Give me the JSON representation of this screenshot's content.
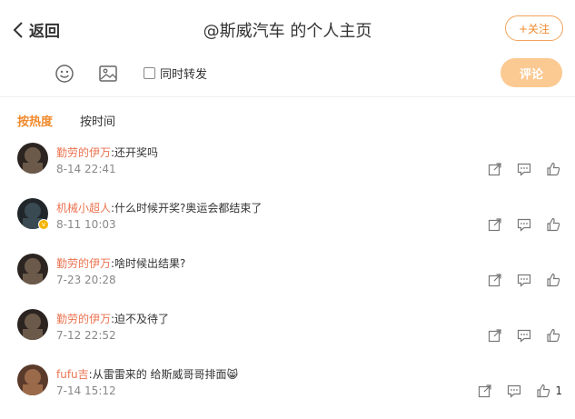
{
  "header": {
    "back_label": "返回",
    "title": "@斯威汽车 的个人主页",
    "follow_label": "+关注"
  },
  "toolbar": {
    "icons": [
      "emoji-icon",
      "image-icon"
    ],
    "repost_label": "同时转发",
    "comment_button": "评论"
  },
  "tabs": {
    "hot": "按热度",
    "time": "按时间"
  },
  "colors": {
    "accent": "#f08a2c",
    "username": "#eb7350",
    "comment_button_bg": "#fbc992",
    "meta": "#888888"
  },
  "comments": [
    {
      "user": "勤劳的伊万",
      "text": ":还开奖吗",
      "time": "8-14 22:41",
      "verified": false,
      "likes": ""
    },
    {
      "user": "机械小超人",
      "text": ":什么时候开奖?奥运会都结束了",
      "time": "8-11 10:03",
      "verified": true,
      "likes": ""
    },
    {
      "user": "勤劳的伊万",
      "text": ":啥时候出结果?",
      "time": "7-23 20:28",
      "verified": false,
      "likes": ""
    },
    {
      "user": "勤劳的伊万",
      "text": ":迫不及待了",
      "time": "7-12 22:52",
      "verified": false,
      "likes": ""
    },
    {
      "user": "fufu吉",
      "text": ":从雷雷来的 给斯威哥哥排面",
      "emoji": "😸",
      "time": "7-14 15:12",
      "verified": false,
      "likes": "1"
    }
  ]
}
